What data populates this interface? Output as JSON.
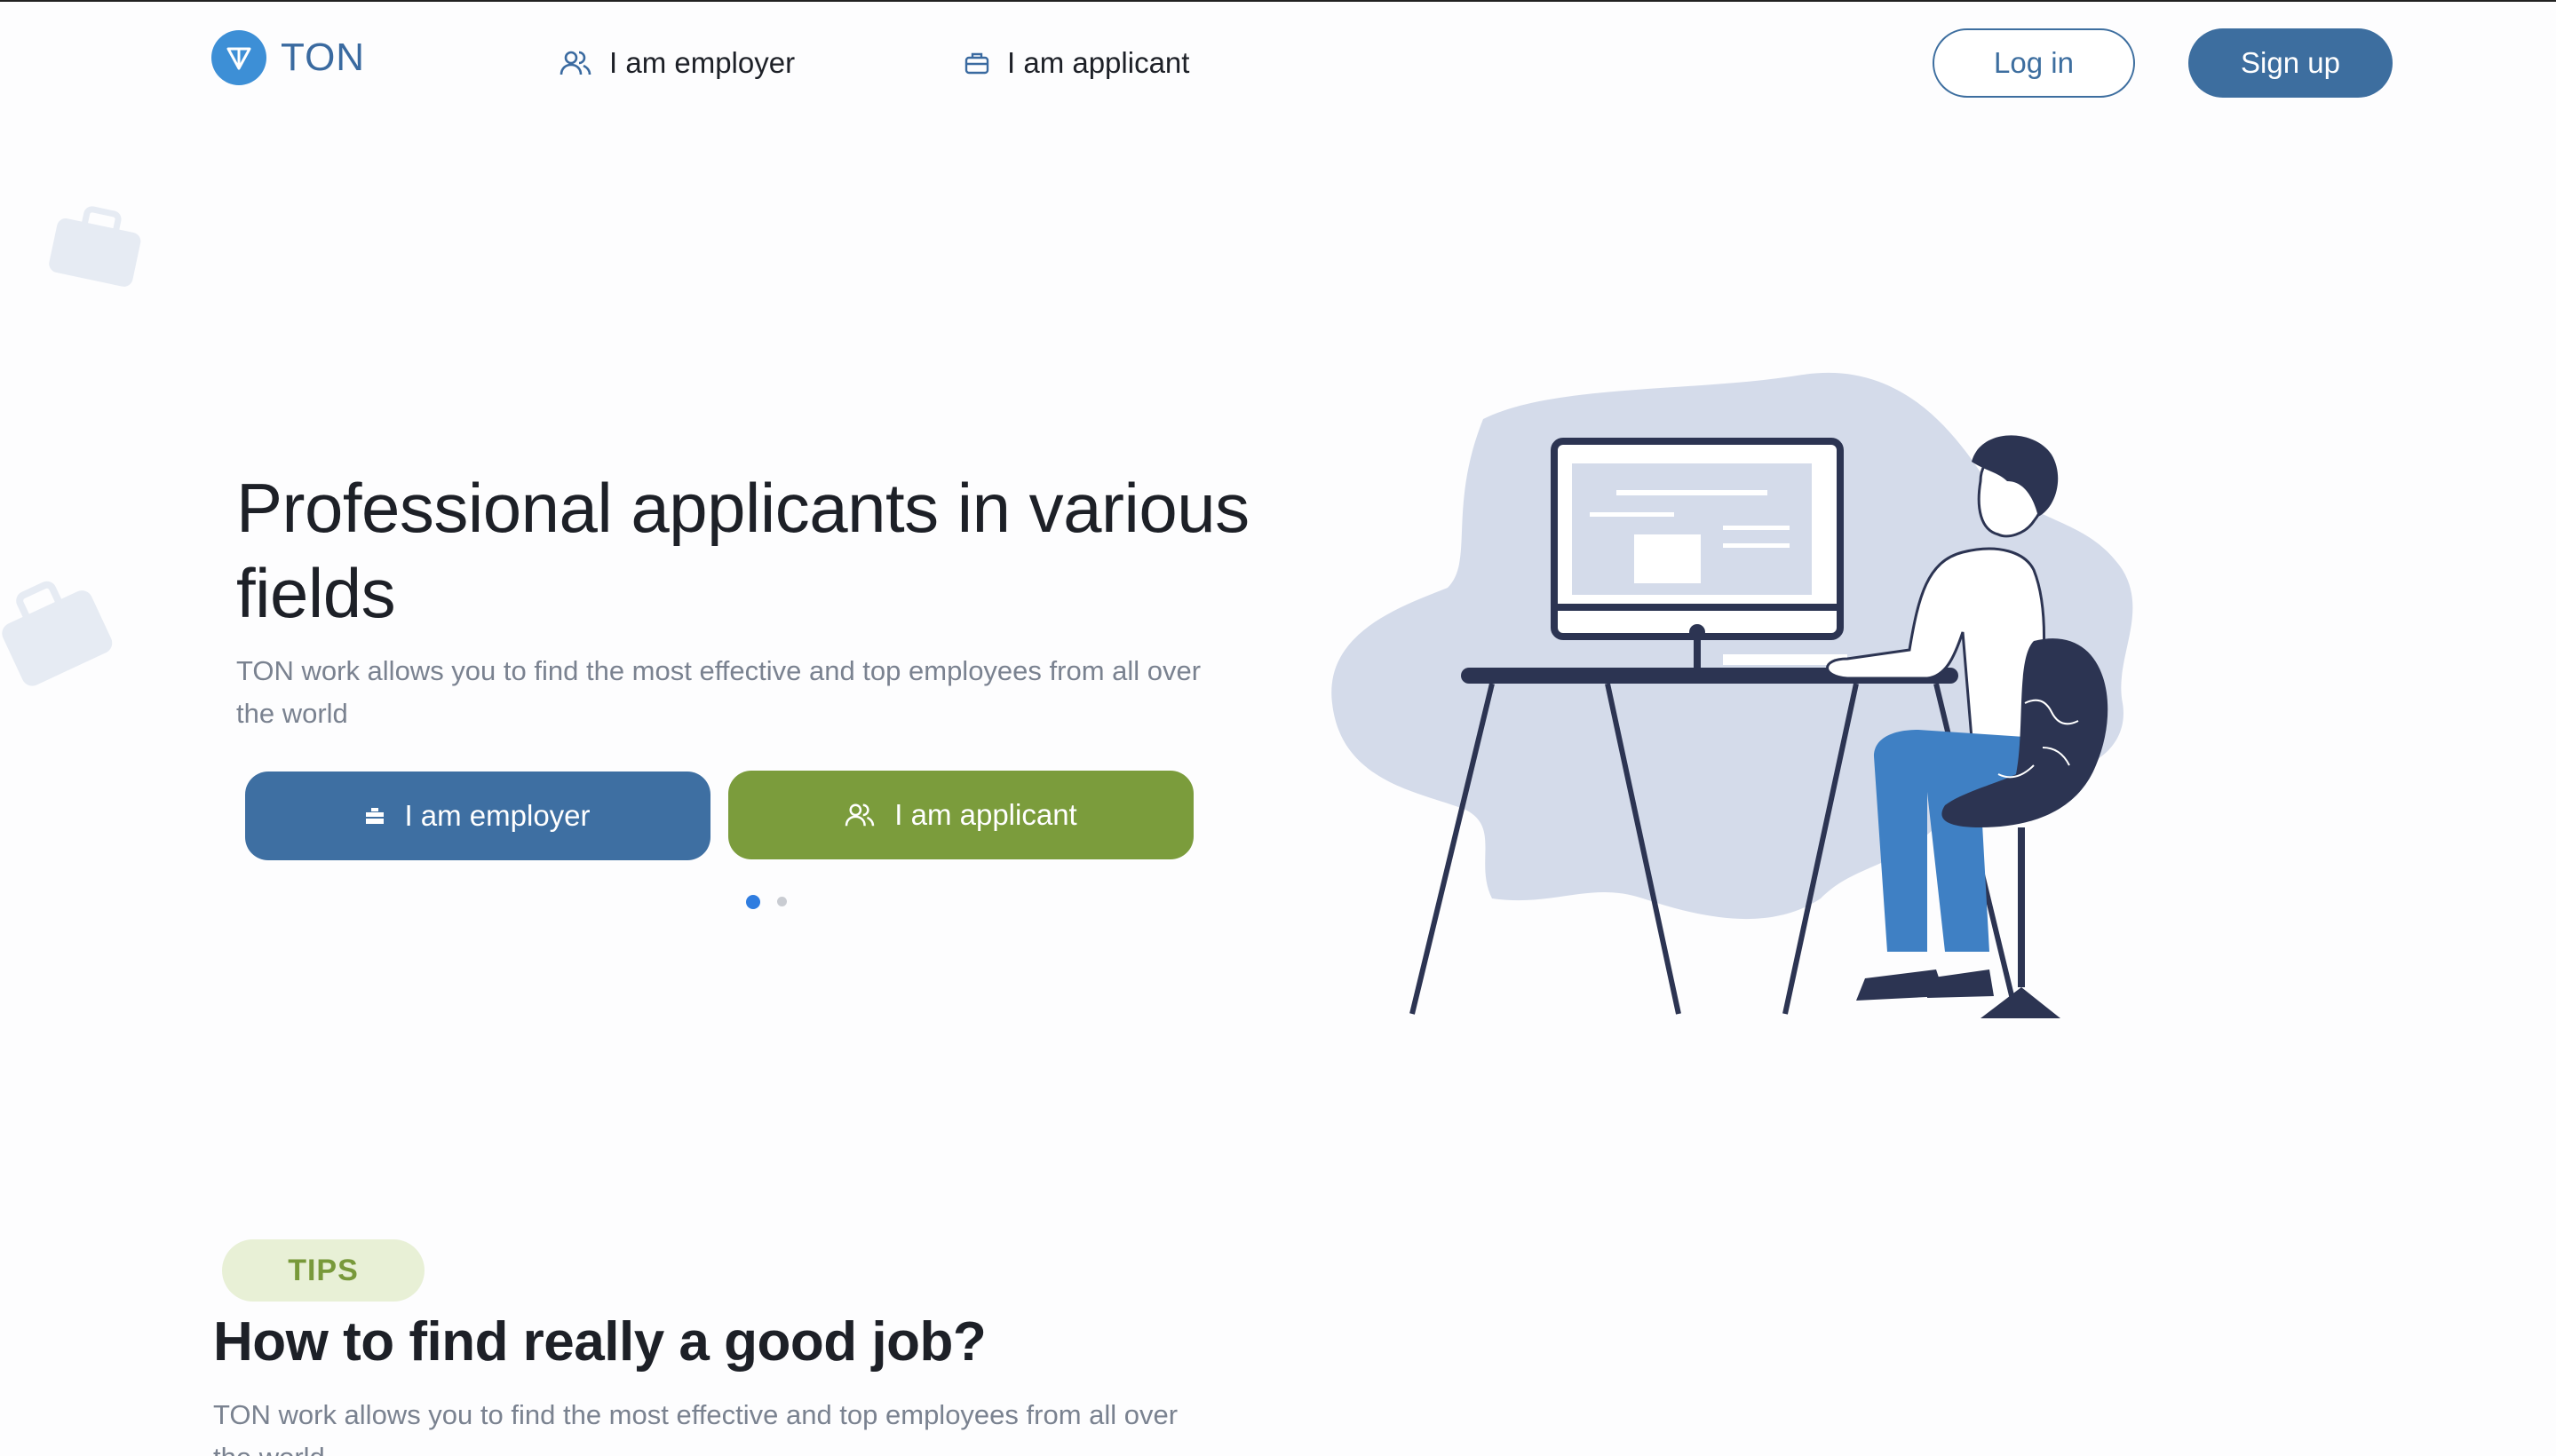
{
  "header": {
    "logo_text": "TON",
    "nav": {
      "employer_label": "I am employer",
      "applicant_label": "I am applicant"
    },
    "login_label": "Log in",
    "signup_label": "Sign up"
  },
  "hero": {
    "title_line1": "Professional applicants in various",
    "title_line2": "fields",
    "subtitle_line1": "TON work allows you to find the most effective and top employees from all over",
    "subtitle_line2": "the world",
    "cta_employer_label": "I am employer",
    "cta_applicant_label": "I am applicant",
    "carousel_active_index": 0,
    "carousel_count": 2
  },
  "tips": {
    "badge": "TIPS",
    "title": "How to find really a good job?",
    "subtitle_line1": "TON work allows you to find the most effective and top employees from all over",
    "subtitle_line2": "the world"
  },
  "colors": {
    "primary": "#3e6fa2",
    "accent_green": "#7b9c3c",
    "logo_blue": "#3d8fd6",
    "text_muted": "#7a8290",
    "illustration_blob": "#d4dbea",
    "illustration_dark": "#2c3452"
  }
}
